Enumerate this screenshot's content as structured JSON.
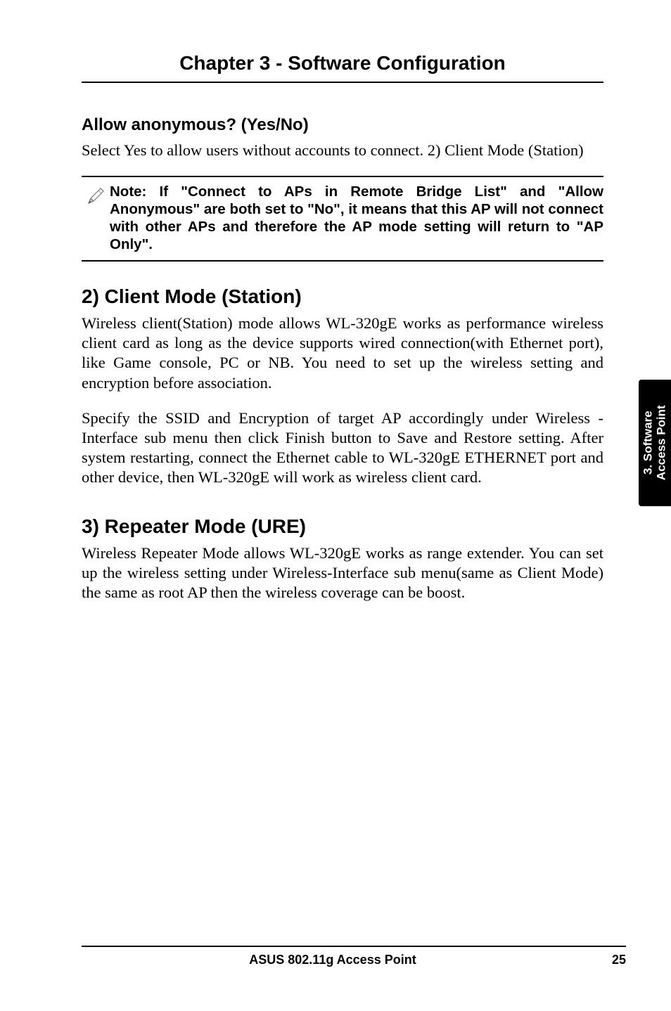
{
  "chapter": {
    "title": "Chapter 3 - Software Configuration"
  },
  "sections": {
    "allow_anon": {
      "heading": "Allow anonymous? (Yes/No)",
      "body": "Select Yes to allow users without accounts to connect. 2) Client Mode (Station)"
    },
    "note": {
      "text": "Note: If \"Connect to APs in Remote Bridge List\" and \"Allow Anonymous\" are both set to \"No\", it means that this AP will not connect with other APs and therefore the AP mode setting will return to \"AP Only\"."
    },
    "client_mode": {
      "heading": "2) Client Mode (Station)",
      "p1": "Wireless client(Station) mode allows WL-320gE works as performance wireless client card as long as the device supports wired connection(with Ethernet port), like Game console, PC or NB. You need to set up the wireless setting and encryption before association.",
      "p2": "Specify the SSID and Encryption of target AP accordingly under Wireless - Interface sub menu then click Finish button to Save and Restore setting. After system restarting, connect the Ethernet cable to WL-320gE ETHERNET port and other device, then WL-320gE will work as wireless client card."
    },
    "repeater_mode": {
      "heading": "3) Repeater Mode (URE)",
      "p1": "Wireless Repeater Mode allows WL-320gE works as range extender. You can set up the wireless setting under Wireless-Interface sub menu(same as Client Mode) the same as root AP then the wireless coverage can be boost."
    }
  },
  "side_tab": {
    "line1": "3. Software",
    "line2": "Access Point"
  },
  "footer": {
    "center": "ASUS 802.11g Access Point",
    "page": "25"
  }
}
